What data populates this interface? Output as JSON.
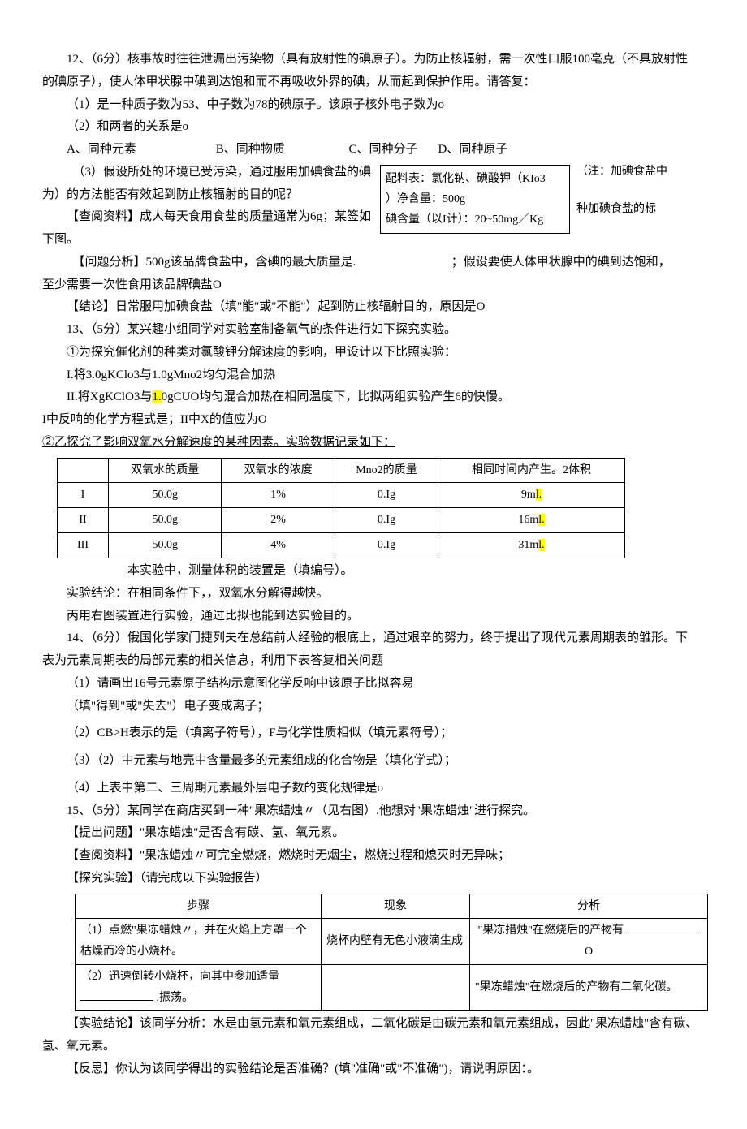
{
  "q12": {
    "header": "12、（6分）核事故时往往泄漏出污染物（具有放射性的碘原子）。为防止核辐射，需一次性口服100毫克（不具放射性的碘原子），使人体甲状腺中碘到达饱和而不再吸收外界的碘，从而起到保护作用。请答复：",
    "p1": "（1）是一种质子数为53、中子数为78的碘原子。该原子核外电子数为o",
    "p2": "（2）和两者的关系是o",
    "optA": "A、同种元素",
    "optB": "B、同种物质",
    "optC": "C、同种分子",
    "optD": "D、同种原子",
    "p3a": "（3）假设所处的环境已受污染，通过服用加碘食盐的碘为）的方法能否有效起到防止核辐射的目的呢？",
    "note1": "（注：加碘食盐中",
    "box_line1": "配料表：氯化钠、碘酸钾（KIo3",
    "box_line2": "）净含量：500g",
    "box_line3": "碘含量（以I计）：20~50mg／Kg",
    "lookup": "【查阅资料】成人每天食用食盐的质量通常为6g；某签如下图。",
    "note2": "种加碘食盐的标",
    "analysis": "【问题分析】500g该品牌食盐中，含碘的最大质量是.",
    "analysis_tail": "；假设要使人体甲状腺中的碘到达饱和，",
    "analysis2": "至少需要一次性食用该品牌碘盐O",
    "conclusion": "【结论】日常服用加碘食盐（填\"能\"或\"不能\"）起到防止核辐射目的，原因是O"
  },
  "q13": {
    "header": "13、（5分）某兴趣小组同学对实验室制备氧气的条件进行如下探究实验。",
    "p1": "①为探究催化剂的种类对氯酸钾分解速度的影响，甲设计以下比照实验：",
    "i": "I.将3.0gKClo3与1.0gMno2均匀混合加热",
    "ii_a": "II.将XgKClO3与",
    "ii_hl": "1.",
    "ii_b": "0gCUO均匀混合加热在相同温度下，比拟两组实验产生6的快慢。",
    "eq": "I中反响的化学方程式是；II中X的值应为O",
    "p2": "②乙探究了影响双氧水分解速度的某种因素。实验数据记录如下：",
    "th1": "双氧水的质量",
    "th2": "双氧水的浓度",
    "th3": "Mno2的质量",
    "th4": "相同时间内产生。2体积",
    "r1": {
      "lbl": "I",
      "c1": "50.0g",
      "c2": "1%",
      "c3": "0.Ig",
      "c4a": "9m",
      "c4hl": "l."
    },
    "r2": {
      "lbl": "II",
      "c1": "50.0g",
      "c2": "2%",
      "c3": "0.Ig",
      "c4a": "16m",
      "c4hl": "l."
    },
    "r3": {
      "lbl": "III",
      "c1": "50.0g",
      "c2": "4%",
      "c3": "0.Ig",
      "c4a": "31m",
      "c4hl": "l."
    },
    "caption": "本实验中，测量体积的装置是（填编号）。",
    "conc": "实验结论：在相同条件下，，双氧水分解得越快。",
    "bing": "丙用右图装置进行实验，通过比拟也能到达实验目的。"
  },
  "q14": {
    "header": "14、（6分）俄国化学家门捷列夫在总结前人经验的根底上，通过艰辛的努力，终于提出了现代元素周期表的雏形。下表为元素周期表的局部元素的相关信息，利用下表答复相关问题",
    "p1": "（1）请画出16号元素原子结构示意图化学反响中该原子比拟容易",
    "p1b": "（填\"得到\"或\"失去\"）电子变成离子；",
    "p2": "（2）CB>H表示的是（填离子符号），F与化学性质相似（填元素符号）；",
    "p3": "（3）（2）中元素与地壳中含量最多的元素组成的化合物是（填化学式）；",
    "p4": "（4）上表中第二、三周期元素最外层电子数的变化规律是o"
  },
  "q15": {
    "header": "15、（5分）某同学在商店买到一种\"果冻蜡烛〃（见右图）.他想对\"果冻蜡烛\"进行探究。",
    "ask": "【提出问题】\"果冻蜡烛\"是否含有碳、氢、氧元素。",
    "lookup": "【查阅资料】\"果冻蜡烛〃可完全燃烧，燃烧时无烟尘，燃烧过程和熄灭时无异味；",
    "exp_head": "【探究实验】（请完成以下实验报告）",
    "th1": "步骤",
    "th2": "现象",
    "th3": "分析",
    "row1_step": "（1）点燃\"果冻蜡烛〃，并在火焰上方罩一个枯燥而冷的小烧杯。",
    "row1_phen": "烧杯内壁有无色小液滴生成",
    "row1_ana_a": "\"果冻措烛\"在燃烧后的产物有",
    "row1_ana_b": "O",
    "row2_step_a": "（2）迅速倒转小烧杯，向其中参加适量",
    "row2_step_b": ",振荡。",
    "row2_ana": "\"果冻蜡烛\"在燃烧后的产物有二氧化碳。",
    "conc": "【实验结论】该同学分析：水是由氢元素和氧元素组成，二氧化碳是由碳元素和氧元素组成，因此\"果冻蜡烛\"含有碳、氢、氧元素。",
    "reflect": "【反思】你认为该同学得出的实验结论是否准确？(填\"准确\"或\"不准确\")，请说明原因：。"
  }
}
